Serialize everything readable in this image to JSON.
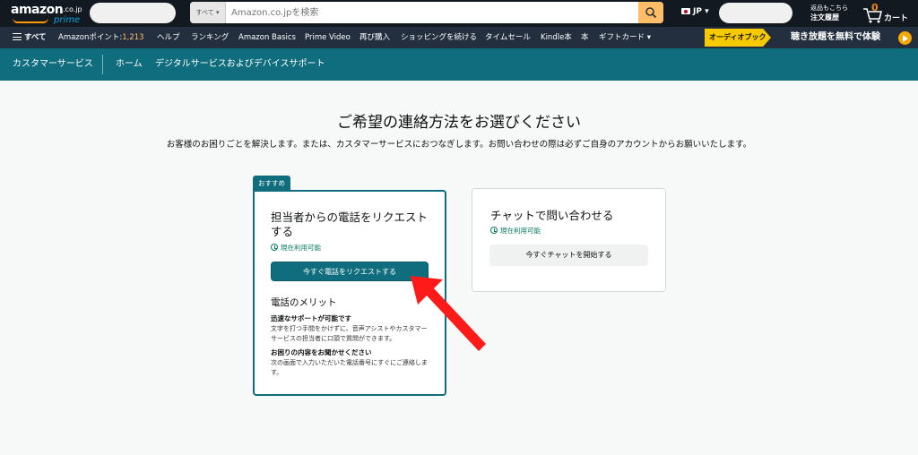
{
  "header": {
    "logo_word": "amazon",
    "logo_tld": ".co.jp",
    "logo_prime": "prime",
    "search_category": "すべて ▾",
    "search_placeholder": "Amazon.co.jpを検索",
    "lang": "JP",
    "orders_line1": "返品もこちら",
    "orders_line2": "注文履歴",
    "cart_count": "0",
    "cart_label": "カート"
  },
  "nav": {
    "all": "すべて",
    "points_label": "Amazonポイント:",
    "points_value": "1,213",
    "items": [
      "ヘルプ",
      "ランキング",
      "Amazon Basics",
      "Prime Video",
      "再び購入",
      "ショッピングを続ける",
      "タイムセール",
      "Kindle本",
      "本",
      "ギフトカード ▾"
    ],
    "promo_badge": "オーディオブック",
    "promo_text": "聴き放題を無料で体験"
  },
  "cs": {
    "title": "カスタマーサービス",
    "home": "ホーム",
    "digital": "デジタルサービスおよびデバイスサポート"
  },
  "main": {
    "heading": "ご希望の連絡方法をお選びください",
    "subtext": "お客様のお困りごとを解決します。または、カスタマーサービスにおつなぎします。お問い合わせの際は必ずご自身のアカウントからお願いいたします。"
  },
  "phone_card": {
    "badge": "おすすめ",
    "title": "担当者からの電話をリクエストする",
    "availability": "現在利用可能",
    "button": "今すぐ電話をリクエストする",
    "merit_heading": "電話のメリット",
    "merit1_title": "迅速なサポートが可能です",
    "merit1_text": "文字を打つ手間をかけずに、音声アシストやカスタマーサービスの担当者に口頭で質問ができます。",
    "merit2_title": "お困りの内容をお聞かせください",
    "merit2_text": "次の画面で入力いただいた電話番号にすぐにご連絡します。"
  },
  "chat_card": {
    "title": "チャットで問い合わせる",
    "availability": "現在利用可能",
    "button": "今すぐチャットを開始する"
  },
  "colors": {
    "teal": "#0f6d7e",
    "nav_dark": "#131921",
    "nav_mid": "#232f3e",
    "arrow_red": "#ff1a1a"
  }
}
